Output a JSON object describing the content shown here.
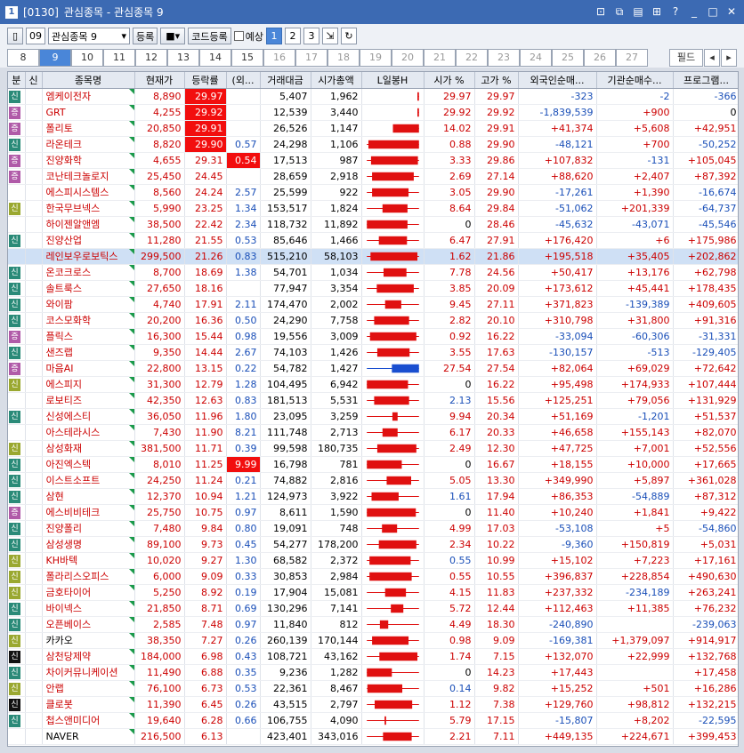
{
  "window": {
    "code": "[0130]",
    "title": "관심종목 - 관심종목 9"
  },
  "toolbar": {
    "group_num": "09",
    "group_name": "관심종목 9",
    "register": "등록",
    "code_register": "코드등록",
    "forecast": "예상",
    "pages": [
      "1",
      "2",
      "3"
    ]
  },
  "tabs": [
    "8",
    "9",
    "10",
    "11",
    "12",
    "13",
    "14",
    "15",
    "16",
    "17",
    "18",
    "19",
    "20",
    "21",
    "22",
    "23",
    "24",
    "25",
    "26",
    "27"
  ],
  "field_label": "필드",
  "colors": {
    "red": "#c00",
    "blue": "#1a4fb8",
    "up_bg": "#f20e0e"
  },
  "headers": [
    "분",
    "신",
    "종목명",
    "현재가",
    "등락률",
    "(외...",
    "거래대금",
    "시가총액",
    "L일봉H",
    "시가 %",
    "고가 %",
    "외국인순매...",
    "기관순매수...",
    "프로그램..."
  ],
  "rows": [
    {
      "b": "신",
      "bt": "sin",
      "name": "엠케이전자",
      "price": "8,890",
      "chg": "29.97",
      "f": "",
      "vol": "5,407",
      "cap": "1,962",
      "open": "29.97",
      "high": "29.97",
      "foreign": "-323",
      "inst": "-2",
      "prog": "-366",
      "hlchg": true,
      "hlf": false,
      "c": {
        "lo": 0.97,
        "hi": 1.0,
        "o": 0.97,
        "cl": 1.0
      }
    },
    {
      "b": "증",
      "bt": "jeung",
      "name": "GRT",
      "price": "4,255",
      "chg": "29.92",
      "f": "",
      "vol": "12,539",
      "cap": "3,440",
      "open": "29.92",
      "high": "29.92",
      "foreign": "-1,839,539",
      "inst": "+900",
      "prog": "0",
      "hlchg": true,
      "hlf": false,
      "c": {
        "lo": 0.97,
        "hi": 1.0,
        "o": 0.97,
        "cl": 1.0
      }
    },
    {
      "b": "증",
      "bt": "jeung",
      "name": "폴리토",
      "price": "20,850",
      "chg": "29.91",
      "f": "",
      "vol": "26,526",
      "cap": "1,147",
      "open": "14.02",
      "high": "29.91",
      "foreign": "+41,374",
      "inst": "+5,608",
      "prog": "+42,951",
      "hlchg": true,
      "hlf": false,
      "c": {
        "lo": 0.5,
        "hi": 1.0,
        "o": 0.5,
        "cl": 1.0
      }
    },
    {
      "b": "신",
      "bt": "sin",
      "name": "라온테크",
      "price": "8,820",
      "chg": "29.90",
      "f": "0.57",
      "vol": "24,298",
      "cap": "1,106",
      "open": "0.88",
      "high": "29.90",
      "foreign": "-48,121",
      "inst": "+700",
      "prog": "-50,252",
      "hlchg": true,
      "hlf": false,
      "c": {
        "lo": 0.0,
        "hi": 1.0,
        "o": 0.03,
        "cl": 1.0
      }
    },
    {
      "b": "증",
      "bt": "jeung",
      "name": "진양화학",
      "price": "4,655",
      "chg": "29.31",
      "f": "0.54",
      "vol": "17,513",
      "cap": "987",
      "open": "3.33",
      "high": "29.86",
      "foreign": "+107,832",
      "inst": "-131",
      "prog": "+105,045",
      "hlchg": false,
      "hlf": true,
      "c": {
        "lo": 0.0,
        "hi": 1.0,
        "o": 0.08,
        "cl": 0.98
      }
    },
    {
      "b": "증",
      "bt": "jeung",
      "name": "코난테크놀로지",
      "price": "25,450",
      "chg": "24.45",
      "f": "",
      "vol": "28,659",
      "cap": "2,918",
      "open": "2.69",
      "high": "27.14",
      "foreign": "+88,620",
      "inst": "+2,407",
      "prog": "+87,392",
      "hlchg": false,
      "hlf": false,
      "c": {
        "lo": 0.0,
        "hi": 1.0,
        "o": 0.1,
        "cl": 0.9
      }
    },
    {
      "b": "",
      "bt": "",
      "name": "에스피시스템스",
      "price": "8,560",
      "chg": "24.24",
      "f": "2.57",
      "vol": "25,599",
      "cap": "922",
      "open": "3.05",
      "high": "29.90",
      "foreign": "-17,261",
      "inst": "+1,390",
      "prog": "-16,674",
      "hlchg": false,
      "hlf": false,
      "c": {
        "lo": 0.0,
        "hi": 1.0,
        "o": 0.1,
        "cl": 0.8
      }
    },
    {
      "b": "신",
      "bt": "yellow",
      "name": "한국무브넥스",
      "price": "5,990",
      "chg": "23.25",
      "f": "1.34",
      "vol": "153,517",
      "cap": "1,824",
      "open": "8.64",
      "high": "29.84",
      "foreign": "-51,062",
      "inst": "+201,339",
      "prog": "-64,737",
      "hlchg": false,
      "hlf": false,
      "c": {
        "lo": 0.0,
        "hi": 1.0,
        "o": 0.3,
        "cl": 0.78
      }
    },
    {
      "b": "",
      "bt": "",
      "name": "하이젠알앤엠",
      "price": "38,500",
      "chg": "22.42",
      "f": "2.34",
      "vol": "118,732",
      "cap": "11,892",
      "open": "0",
      "high": "28.46",
      "foreign": "-45,632",
      "inst": "-43,071",
      "prog": "-45,546",
      "hlchg": false,
      "hlf": false,
      "c": {
        "lo": 0.0,
        "hi": 1.0,
        "o": 0.0,
        "cl": 0.78
      }
    },
    {
      "b": "신",
      "bt": "sin",
      "name": "진양산업",
      "price": "11,280",
      "chg": "21.55",
      "f": "0.53",
      "vol": "85,646",
      "cap": "1,466",
      "open": "6.47",
      "high": "27.91",
      "foreign": "+176,420",
      "inst": "+6",
      "prog": "+175,986",
      "hlchg": false,
      "hlf": false,
      "c": {
        "lo": 0.0,
        "hi": 1.0,
        "o": 0.23,
        "cl": 0.77
      }
    },
    {
      "b": "",
      "bt": "",
      "name": "레인보우로보틱스",
      "price": "299,500",
      "chg": "21.26",
      "f": "0.83",
      "vol": "515,210",
      "cap": "58,103",
      "open": "1.62",
      "high": "21.86",
      "foreign": "+195,518",
      "inst": "+35,405",
      "prog": "+202,862",
      "hlchg": false,
      "hlf": false,
      "sel": true,
      "c": {
        "lo": 0.0,
        "hi": 1.0,
        "o": 0.07,
        "cl": 0.97
      }
    },
    {
      "b": "신",
      "bt": "sin",
      "name": "온코크로스",
      "price": "8,700",
      "chg": "18.69",
      "f": "1.38",
      "vol": "54,701",
      "cap": "1,034",
      "open": "7.78",
      "high": "24.56",
      "foreign": "+50,417",
      "inst": "+13,176",
      "prog": "+62,798",
      "hlchg": false,
      "hlf": false,
      "c": {
        "lo": 0.0,
        "hi": 1.0,
        "o": 0.32,
        "cl": 0.76
      }
    },
    {
      "b": "신",
      "bt": "sin",
      "name": "솔트룩스",
      "price": "27,650",
      "chg": "18.16",
      "f": "",
      "vol": "77,947",
      "cap": "3,354",
      "open": "3.85",
      "high": "20.09",
      "foreign": "+173,612",
      "inst": "+45,441",
      "prog": "+178,435",
      "hlchg": false,
      "hlf": false,
      "c": {
        "lo": 0.0,
        "hi": 1.0,
        "o": 0.19,
        "cl": 0.9
      }
    },
    {
      "b": "신",
      "bt": "sin",
      "name": "와이팜",
      "price": "4,740",
      "chg": "17.91",
      "f": "2.11",
      "vol": "174,470",
      "cap": "2,002",
      "open": "9.45",
      "high": "27.11",
      "foreign": "+371,823",
      "inst": "-139,389",
      "prog": "+409,605",
      "hlchg": false,
      "hlf": false,
      "c": {
        "lo": 0.0,
        "hi": 1.0,
        "o": 0.35,
        "cl": 0.66
      }
    },
    {
      "b": "신",
      "bt": "sin",
      "name": "코스모화학",
      "price": "20,200",
      "chg": "16.36",
      "f": "0.50",
      "vol": "24,290",
      "cap": "7,758",
      "open": "2.82",
      "high": "20.10",
      "foreign": "+310,798",
      "inst": "+31,800",
      "prog": "+91,316",
      "hlchg": false,
      "hlf": false,
      "c": {
        "lo": 0.0,
        "hi": 1.0,
        "o": 0.14,
        "cl": 0.81
      }
    },
    {
      "b": "증",
      "bt": "jeung",
      "name": "플릭스",
      "price": "16,300",
      "chg": "15.44",
      "f": "0.98",
      "vol": "19,556",
      "cap": "3,009",
      "open": "0.92",
      "high": "16.22",
      "foreign": "-33,094",
      "inst": "-60,306",
      "prog": "-31,331",
      "hlchg": false,
      "hlf": false,
      "c": {
        "lo": 0.0,
        "hi": 1.0,
        "o": 0.06,
        "cl": 0.95
      }
    },
    {
      "b": "신",
      "bt": "sin",
      "name": "샌즈랩",
      "price": "9,350",
      "chg": "14.44",
      "f": "2.67",
      "vol": "74,103",
      "cap": "1,426",
      "open": "3.55",
      "high": "17.63",
      "foreign": "-130,157",
      "inst": "-513",
      "prog": "-129,405",
      "hlchg": false,
      "hlf": false,
      "c": {
        "lo": 0.0,
        "hi": 1.0,
        "o": 0.2,
        "cl": 0.82
      }
    },
    {
      "b": "증",
      "bt": "jeung",
      "name": "마음AI",
      "price": "22,800",
      "chg": "13.15",
      "f": "0.22",
      "vol": "54,782",
      "cap": "1,427",
      "open": "27.54",
      "high": "27.54",
      "foreign": "+82,064",
      "inst": "+69,029",
      "prog": "+72,642",
      "hlchg": false,
      "hlf": false,
      "blue": true,
      "c": {
        "lo": 0.0,
        "hi": 1.0,
        "o": 1.0,
        "cl": 0.48
      }
    },
    {
      "b": "신",
      "bt": "yellow",
      "name": "에스피지",
      "price": "31,300",
      "chg": "12.79",
      "f": "1.28",
      "vol": "104,495",
      "cap": "6,942",
      "open": "0",
      "high": "16.22",
      "foreign": "+95,498",
      "inst": "+174,933",
      "prog": "+107,444",
      "hlchg": false,
      "hlf": false,
      "c": {
        "lo": 0.0,
        "hi": 1.0,
        "o": 0.0,
        "cl": 0.79
      }
    },
    {
      "b": "",
      "bt": "",
      "name": "로보티즈",
      "price": "42,350",
      "chg": "12.63",
      "f": "0.83",
      "vol": "181,513",
      "cap": "5,531",
      "open": "2.13",
      "high": "15.56",
      "foreign": "+125,251",
      "inst": "+79,056",
      "prog": "+131,929",
      "hlchg": false,
      "hlf": false,
      "blueopen": true,
      "c": {
        "lo": 0.0,
        "hi": 1.0,
        "o": 0.14,
        "cl": 0.81
      }
    },
    {
      "b": "신",
      "bt": "sin",
      "name": "신성에스티",
      "price": "36,050",
      "chg": "11.96",
      "f": "1.80",
      "vol": "23,095",
      "cap": "3,259",
      "open": "9.94",
      "high": "20.34",
      "foreign": "+51,169",
      "inst": "-1,201",
      "prog": "+51,537",
      "hlchg": false,
      "hlf": false,
      "c": {
        "lo": 0.0,
        "hi": 1.0,
        "o": 0.49,
        "cl": 0.59
      }
    },
    {
      "b": "",
      "bt": "",
      "name": "아스테라시스",
      "price": "7,430",
      "chg": "11.90",
      "f": "8.21",
      "vol": "111,748",
      "cap": "2,713",
      "open": "6.17",
      "high": "20.33",
      "foreign": "+46,658",
      "inst": "+155,143",
      "prog": "+82,070",
      "hlchg": false,
      "hlf": false,
      "c": {
        "lo": 0.0,
        "hi": 1.0,
        "o": 0.3,
        "cl": 0.59
      }
    },
    {
      "b": "신",
      "bt": "yellow",
      "name": "삼성화재",
      "price": "381,500",
      "chg": "11.71",
      "f": "0.39",
      "vol": "99,598",
      "cap": "180,735",
      "open": "2.49",
      "high": "12.30",
      "foreign": "+47,725",
      "inst": "+7,001",
      "prog": "+52,556",
      "hlchg": false,
      "hlf": false,
      "c": {
        "lo": 0.0,
        "hi": 1.0,
        "o": 0.2,
        "cl": 0.95
      }
    },
    {
      "b": "신",
      "bt": "sin",
      "name": "아진엑스텍",
      "price": "8,010",
      "chg": "11.25",
      "f": "9.99",
      "vol": "16,798",
      "cap": "781",
      "open": "0",
      "high": "16.67",
      "foreign": "+18,155",
      "inst": "+10,000",
      "prog": "+17,665",
      "hlchg": false,
      "hlf": true,
      "c": {
        "lo": 0.0,
        "hi": 1.0,
        "o": 0.0,
        "cl": 0.67
      }
    },
    {
      "b": "신",
      "bt": "sin",
      "name": "이스트소프트",
      "price": "24,250",
      "chg": "11.24",
      "f": "0.21",
      "vol": "74,882",
      "cap": "2,816",
      "open": "5.05",
      "high": "13.30",
      "foreign": "+349,990",
      "inst": "+5,897",
      "prog": "+361,028",
      "hlchg": false,
      "hlf": false,
      "c": {
        "lo": 0.0,
        "hi": 1.0,
        "o": 0.38,
        "cl": 0.85
      }
    },
    {
      "b": "신",
      "bt": "sin",
      "name": "삼현",
      "price": "12,370",
      "chg": "10.94",
      "f": "1.21",
      "vol": "124,973",
      "cap": "3,922",
      "open": "1.61",
      "high": "17.94",
      "foreign": "+86,353",
      "inst": "-54,889",
      "prog": "+87,312",
      "hlchg": false,
      "hlf": false,
      "blueopen": true,
      "c": {
        "lo": 0.0,
        "hi": 1.0,
        "o": 0.09,
        "cl": 0.61
      }
    },
    {
      "b": "증",
      "bt": "jeung",
      "name": "에스비비테크",
      "price": "25,750",
      "chg": "10.75",
      "f": "0.97",
      "vol": "8,611",
      "cap": "1,590",
      "open": "0",
      "high": "11.40",
      "foreign": "+10,240",
      "inst": "+1,841",
      "prog": "+9,422",
      "hlchg": false,
      "hlf": false,
      "c": {
        "lo": 0.0,
        "hi": 1.0,
        "o": 0.0,
        "cl": 0.94
      }
    },
    {
      "b": "신",
      "bt": "sin",
      "name": "진양폴리",
      "price": "7,480",
      "chg": "9.84",
      "f": "0.80",
      "vol": "19,091",
      "cap": "748",
      "open": "4.99",
      "high": "17.03",
      "foreign": "-53,108",
      "inst": "+5",
      "prog": "-54,860",
      "hlchg": false,
      "hlf": false,
      "c": {
        "lo": 0.0,
        "hi": 1.0,
        "o": 0.29,
        "cl": 0.58
      }
    },
    {
      "b": "신",
      "bt": "sin",
      "name": "삼성생명",
      "price": "89,100",
      "chg": "9.73",
      "f": "0.45",
      "vol": "54,277",
      "cap": "178,200",
      "open": "2.34",
      "high": "10.22",
      "foreign": "-9,360",
      "inst": "+150,819",
      "prog": "+5,031",
      "hlchg": false,
      "hlf": false,
      "c": {
        "lo": 0.0,
        "hi": 1.0,
        "o": 0.23,
        "cl": 0.95
      }
    },
    {
      "b": "신",
      "bt": "yellow",
      "name": "KH바텍",
      "price": "10,020",
      "chg": "9.27",
      "f": "1.30",
      "vol": "68,582",
      "cap": "2,372",
      "open": "0.55",
      "high": "10.99",
      "foreign": "+15,102",
      "inst": "+7,223",
      "prog": "+17,161",
      "hlchg": false,
      "hlf": false,
      "blueopen": true,
      "c": {
        "lo": 0.0,
        "hi": 1.0,
        "o": 0.05,
        "cl": 0.84
      }
    },
    {
      "b": "신",
      "bt": "yellow",
      "name": "폴라리스오피스",
      "price": "6,000",
      "chg": "9.09",
      "f": "0.33",
      "vol": "30,853",
      "cap": "2,984",
      "open": "0.55",
      "high": "10.55",
      "foreign": "+396,837",
      "inst": "+228,854",
      "prog": "+490,630",
      "hlchg": false,
      "hlf": false,
      "c": {
        "lo": 0.0,
        "hi": 1.0,
        "o": 0.05,
        "cl": 0.86
      }
    },
    {
      "b": "신",
      "bt": "yellow",
      "name": "금호타이어",
      "price": "5,250",
      "chg": "8.92",
      "f": "0.19",
      "vol": "17,904",
      "cap": "15,081",
      "open": "4.15",
      "high": "11.83",
      "foreign": "+237,332",
      "inst": "-234,189",
      "prog": "+263,241",
      "hlchg": false,
      "hlf": false,
      "c": {
        "lo": 0.0,
        "hi": 1.0,
        "o": 0.35,
        "cl": 0.75
      }
    },
    {
      "b": "신",
      "bt": "sin",
      "name": "바이넥스",
      "price": "21,850",
      "chg": "8.71",
      "f": "0.69",
      "vol": "130,296",
      "cap": "7,141",
      "open": "5.72",
      "high": "12.44",
      "foreign": "+112,463",
      "inst": "+11,385",
      "prog": "+76,232",
      "hlchg": false,
      "hlf": false,
      "c": {
        "lo": 0.0,
        "hi": 1.0,
        "o": 0.46,
        "cl": 0.7
      }
    },
    {
      "b": "신",
      "bt": "sin",
      "name": "오픈베이스",
      "price": "2,585",
      "chg": "7.48",
      "f": "0.97",
      "vol": "11,840",
      "cap": "812",
      "open": "4.49",
      "high": "18.30",
      "foreign": "-240,890",
      "inst": "",
      "prog": "-239,063",
      "hlchg": false,
      "hlf": false,
      "c": {
        "lo": 0.0,
        "hi": 1.0,
        "o": 0.25,
        "cl": 0.41
      }
    },
    {
      "b": "신",
      "bt": "yellow",
      "name": "카카오",
      "price": "38,350",
      "chg": "7.27",
      "f": "0.26",
      "vol": "260,139",
      "cap": "170,144",
      "open": "0.98",
      "high": "9.09",
      "foreign": "-169,381",
      "inst": "+1,379,097",
      "prog": "+914,917",
      "hlchg": false,
      "hlf": false,
      "blk": true,
      "c": {
        "lo": 0.0,
        "hi": 1.0,
        "o": 0.1,
        "cl": 0.8
      }
    },
    {
      "b": "신",
      "bt": "black",
      "name": "삼천당제약",
      "price": "184,000",
      "chg": "6.98",
      "f": "0.43",
      "vol": "108,721",
      "cap": "43,162",
      "open": "1.74",
      "high": "7.15",
      "foreign": "+132,070",
      "inst": "+22,999",
      "prog": "+132,768",
      "hlchg": false,
      "hlf": false,
      "c": {
        "lo": 0.0,
        "hi": 1.0,
        "o": 0.24,
        "cl": 0.97
      }
    },
    {
      "b": "신",
      "bt": "sin",
      "name": "차이커뮤니케이션",
      "price": "11,490",
      "chg": "6.88",
      "f": "0.35",
      "vol": "9,236",
      "cap": "1,282",
      "open": "0",
      "high": "14.23",
      "foreign": "+17,443",
      "inst": "",
      "prog": "+17,458",
      "hlchg": false,
      "hlf": false,
      "c": {
        "lo": 0.0,
        "hi": 1.0,
        "o": 0.0,
        "cl": 0.48
      }
    },
    {
      "b": "신",
      "bt": "yellow",
      "name": "안랩",
      "price": "76,100",
      "chg": "6.73",
      "f": "0.53",
      "vol": "22,361",
      "cap": "8,467",
      "open": "0.14",
      "high": "9.82",
      "foreign": "+15,252",
      "inst": "+501",
      "prog": "+16,286",
      "hlchg": false,
      "hlf": false,
      "blueopen": true,
      "c": {
        "lo": 0.0,
        "hi": 1.0,
        "o": 0.01,
        "cl": 0.68
      }
    },
    {
      "b": "신",
      "bt": "black",
      "name": "클로봇",
      "price": "11,390",
      "chg": "6.45",
      "f": "0.26",
      "vol": "43,515",
      "cap": "2,797",
      "open": "1.12",
      "high": "7.38",
      "foreign": "+129,760",
      "inst": "+98,812",
      "prog": "+132,215",
      "hlchg": false,
      "hlf": false,
      "c": {
        "lo": 0.0,
        "hi": 1.0,
        "o": 0.15,
        "cl": 0.87
      }
    },
    {
      "b": "신",
      "bt": "sin",
      "name": "첩스앤미디어",
      "price": "19,640",
      "chg": "6.28",
      "f": "0.66",
      "vol": "106,755",
      "cap": "4,090",
      "open": "5.79",
      "high": "17.15",
      "foreign": "-15,807",
      "inst": "+8,202",
      "prog": "-22,595",
      "hlchg": false,
      "hlf": false,
      "c": {
        "lo": 0.0,
        "hi": 1.0,
        "o": 0.34,
        "cl": 0.37
      }
    },
    {
      "b": "",
      "bt": "",
      "name": "NAVER",
      "price": "216,500",
      "chg": "6.13",
      "f": "",
      "vol": "423,401",
      "cap": "343,016",
      "open": "2.21",
      "high": "7.11",
      "foreign": "+449,135",
      "inst": "+224,671",
      "prog": "+399,453",
      "hlchg": false,
      "hlf": false,
      "blk": true,
      "c": {
        "lo": 0.0,
        "hi": 1.0,
        "o": 0.31,
        "cl": 0.86
      }
    }
  ]
}
